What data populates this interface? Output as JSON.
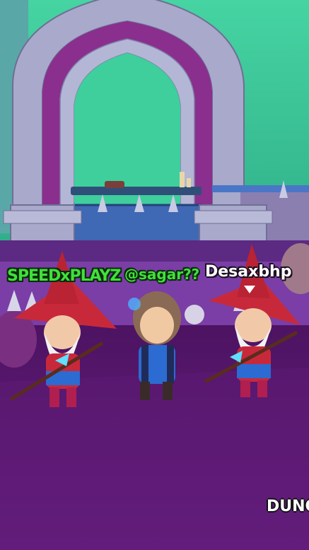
{
  "players": [
    {
      "name": "SPEEDxPLAYZ",
      "color": "#3fe13a"
    },
    {
      "name": "@sagar??",
      "color": "#3fe13a"
    },
    {
      "name": "Desaxbhp",
      "color": "#ffffff"
    }
  ],
  "banner": {
    "text": "DUNG"
  },
  "palette": {
    "sky": "#3cc79a",
    "stone": "#a6a7c9",
    "floor": "#5e1a77",
    "robe_red": "#c8293a",
    "hero_blue": "#2c6bd1"
  }
}
